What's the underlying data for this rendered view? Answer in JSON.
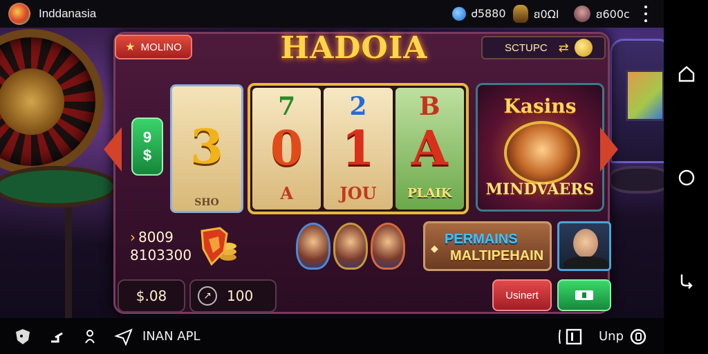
{
  "status_bar": {
    "app_name": "Inddanasia",
    "stats": [
      {
        "icon": "gem-icon",
        "value": "Ꮷ5880"
      },
      {
        "icon": "trophy-icon",
        "value": "ꞛ0ΩΙ"
      },
      {
        "icon": "profile-icon",
        "value": "ꞛ600c"
      }
    ]
  },
  "game": {
    "mode_button": "MOLINO",
    "title": "HADOIA",
    "score_label": "SCTUPC",
    "side_values": [
      "9",
      "$"
    ],
    "single_reel": {
      "top": "",
      "mid": "3",
      "bottom": "SHO"
    },
    "reels": [
      {
        "top": "7",
        "mid": "0",
        "bottom": "A"
      },
      {
        "top": "2",
        "mid": "1",
        "bottom": "JOU"
      },
      {
        "top": "B",
        "mid": "A",
        "bottom": "PLAIK"
      }
    ],
    "feature": {
      "title": "Kasins",
      "subtitle": "MINDVAERS"
    },
    "jackpot": {
      "line1": "8009",
      "line2": "8103300"
    },
    "promo": {
      "line1": "PERMAINS",
      "line2": "MALTIPEHAIN"
    },
    "bet": "$.08",
    "lines_value": "100",
    "red_button": "Usinert"
  },
  "bottom_bar": {
    "label": "INAN APL",
    "right_label": "Unp"
  },
  "colors": {
    "accent_gold": "#ffd54a",
    "accent_red": "#d2432a",
    "accent_green": "#3ad36a",
    "frame_purple": "#4e1b3c"
  }
}
